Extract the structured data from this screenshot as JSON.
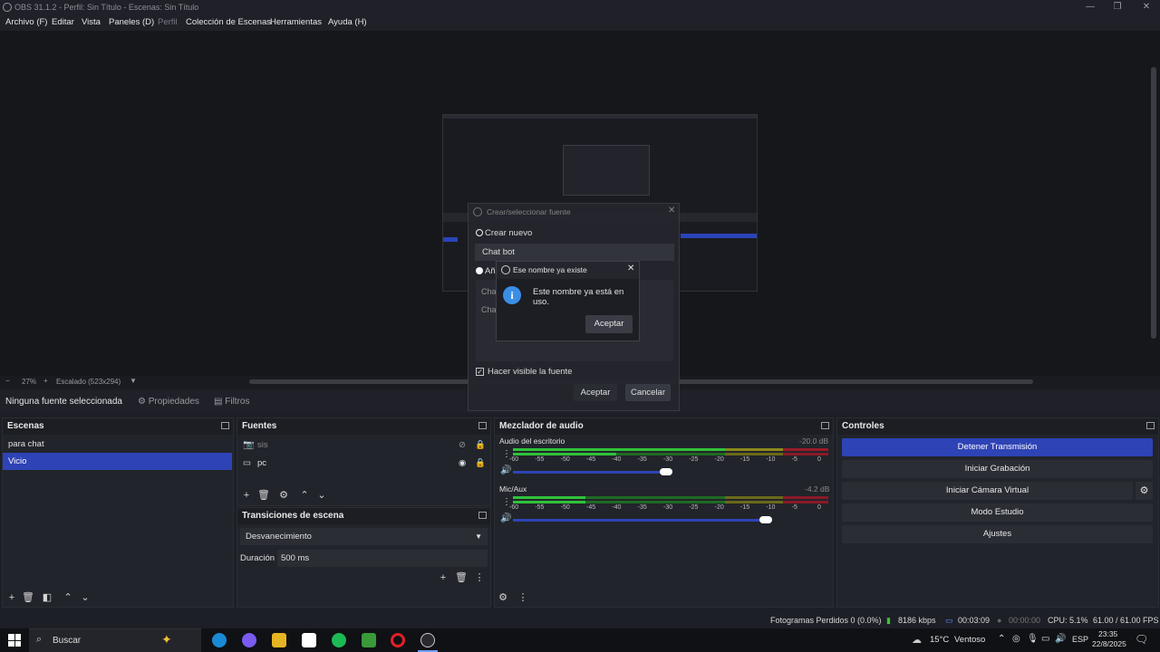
{
  "window": {
    "title": "OBS 31.1.2 - Perfil: Sin Título - Escenas: Sin Título",
    "minimize": "—",
    "maximize": "❐",
    "close": "✕"
  },
  "menubar": [
    "Archivo (F)",
    "Editar",
    "Vista",
    "Paneles (D)",
    "Perfil",
    "Colección de Escenas",
    "Herramientas",
    "Ayuda (H)"
  ],
  "zoom": {
    "minus": "−",
    "value": "27%",
    "plus": "+",
    "scale_label": "Escalado (523x294)"
  },
  "source_bar": {
    "status": "Ninguna fuente seleccionada",
    "properties": "Propiedades",
    "filters": "Filtros"
  },
  "scenes": {
    "title": "Escenas",
    "items": [
      {
        "label": "para chat"
      },
      {
        "label": "Vicio"
      }
    ],
    "selected": 1
  },
  "sources": {
    "title": "Fuentes",
    "items": [
      {
        "label": "sis"
      },
      {
        "label": "pc"
      }
    ]
  },
  "transitions": {
    "title": "Transiciones de escena",
    "type": "Desvanecimiento",
    "duration_label": "Duración",
    "duration_value": "500 ms"
  },
  "mixer": {
    "title": "Mezclador de audio",
    "channels": [
      {
        "name": "Audio del escritorio",
        "db": "-20.0 dB",
        "volume_fraction": 0.98
      },
      {
        "name": "Mic/Aux",
        "db": "-4.2 dB",
        "volume_fraction": 0.97
      }
    ],
    "scale": [
      "-60",
      "-55",
      "-50",
      "-45",
      "-40",
      "-35",
      "-30",
      "-25",
      "-20",
      "-15",
      "-10",
      "-5",
      "0"
    ]
  },
  "controls": {
    "title": "Controles",
    "buttons": [
      "Detener Transmisión",
      "Iniciar Grabación",
      "Iniciar Cámara Virtual",
      "Modo Estudio",
      "Ajustes"
    ]
  },
  "status": {
    "dropped": "Fotogramas Perdidos 0 (0.0%)",
    "bitrate": "8186 kbps",
    "stream_time": "00:03:09",
    "rec_time": "00:00:00",
    "cpu": "CPU: 5.1%",
    "fps": "61.00 / 61.00 FPS"
  },
  "dialog_source": {
    "title": "Crear/seleccionar fuente",
    "create_new": "Crear nuevo",
    "name_value": "Chat bot",
    "add_existing": "Añadir existente",
    "list_items": [
      "Chat",
      "Chat"
    ],
    "visible_label": "Hacer visible la fuente",
    "ok": "Aceptar",
    "cancel": "Cancelar"
  },
  "dialog_error": {
    "title": "Ese nombre ya existe",
    "message": "Este nombre ya está en uso.",
    "ok": "Aceptar"
  },
  "taskbar": {
    "search": "Buscar",
    "weather": "15°C",
    "weather_desc": "Ventoso",
    "lang": "ESP",
    "time": "23:35",
    "date": "22/8/2025"
  },
  "colors": {
    "accent": "#2e43b5",
    "meter_green": "#2fc23a",
    "meter_yellow": "#8a8a1a",
    "meter_red": "#9a1a2a"
  }
}
